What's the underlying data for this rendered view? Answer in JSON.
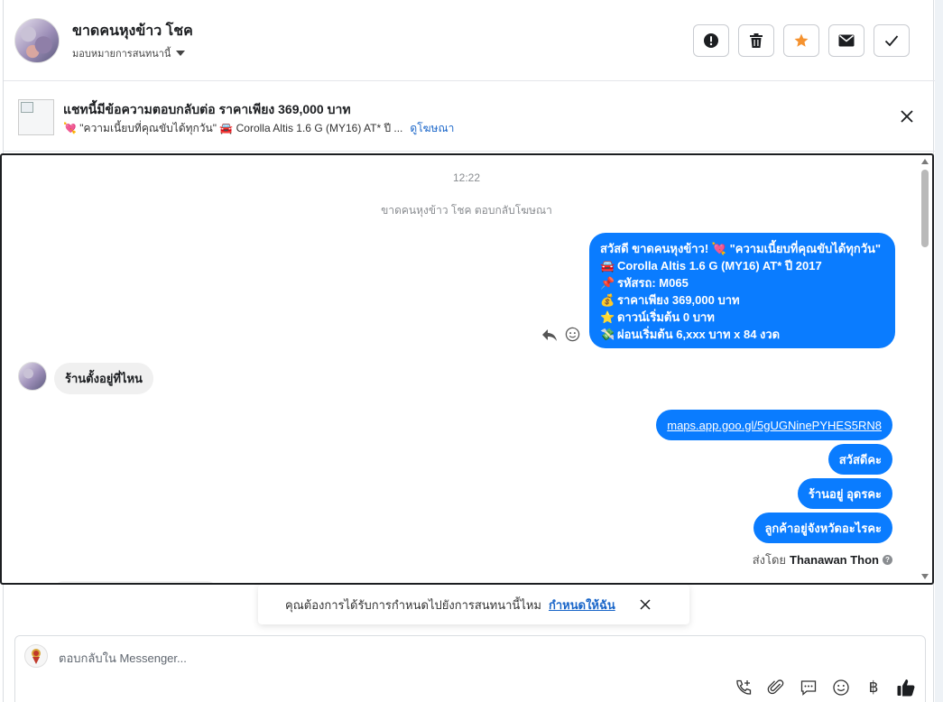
{
  "header": {
    "contact_name": "ขาดคนหุงข้าว โชค",
    "assign_label": "มอบหมายการสนทนานี้",
    "actions": [
      {
        "icon": "alert-icon",
        "name": "alert-button"
      },
      {
        "icon": "trash-icon",
        "name": "delete-button"
      },
      {
        "icon": "star-icon",
        "name": "star-button"
      },
      {
        "icon": "envelope-icon",
        "name": "mark-unread-button"
      },
      {
        "icon": "check-icon",
        "name": "mark-done-button"
      }
    ],
    "star_color": "#f5922f"
  },
  "ad": {
    "title": "แชทนี้มีข้อความตอบกลับต่อ ราคาเพียง 369,000 บาท",
    "subtitle": "💘 \"ความเนี้ยบที่คุณขับได้ทุกวัน\" 🚘 Corolla Altis 1.6 G (MY16) AT* ปี ...",
    "link": "ดูโฆษณา"
  },
  "chat": {
    "time": "12:22",
    "system": "ขาดคนหุงข้าว โชค ตอบกลับโฆษณา",
    "ad_message": [
      {
        "emoji": "",
        "text": "สวัสดี ขาดคนหุงข้าว! 💘 \"ความเนี้ยบที่คุณขับได้ทุกวัน\""
      },
      {
        "emoji": "🚘",
        "text": "Corolla Altis 1.6 G (MY16) AT* ปี 2017"
      },
      {
        "emoji": "📌",
        "text": "รหัสรถ: M065"
      },
      {
        "emoji": "💰",
        "text": "ราคาเพียง 369,000 บาท"
      },
      {
        "emoji": "⭐",
        "text": "ดาวน์เริ่มต้น 0 บาท"
      },
      {
        "emoji": "💸",
        "text": "ผ่อนเริ่มต้น 6,xxx บาท x 84 งวด"
      }
    ],
    "incoming": "ร้านตั้งอยู่ที่ไหน",
    "outgoing": [
      "maps.app.goo.gl/5gUGNinePYHES5RN8",
      "สวัสดีคะ",
      "ร้านอยู่ อุดรคะ",
      "ลูกค้าอยู่จังหวัดอะไรคะ"
    ],
    "sent_by_label": "ส่งโดย",
    "sent_by_name": "Thanawan Thon",
    "bubble_color": "#0a7cff"
  },
  "toast": {
    "text": "คุณต้องการได้รับการกำหนดไปยังการสนทนานี้ไหม",
    "link": "กำหนดให้ฉัน"
  },
  "composer": {
    "placeholder": "ตอบกลับใน Messenger...",
    "tools": [
      "call-add-icon",
      "attach-icon",
      "saved-reply-icon",
      "emoji-icon",
      "baht-icon",
      "thumbs-up-icon"
    ],
    "baht_symbol": "฿"
  }
}
